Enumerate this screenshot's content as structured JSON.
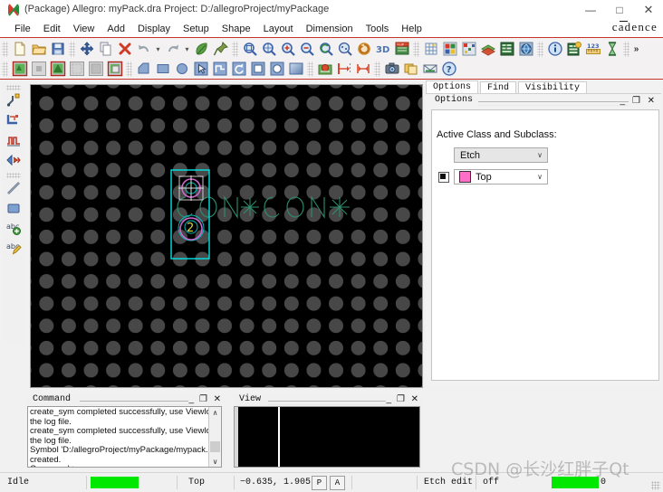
{
  "window": {
    "title": "(Package) Allegro: myPack.dra   Project: D:/allegroProject/myPackage",
    "app_icon": "allegro-icon",
    "minimize": "—",
    "maximize": "□",
    "close": "✕",
    "brand": "cadence"
  },
  "menu": {
    "items": [
      {
        "label": "File"
      },
      {
        "label": "Edit"
      },
      {
        "label": "View"
      },
      {
        "label": "Add"
      },
      {
        "label": "Display"
      },
      {
        "label": "Setup"
      },
      {
        "label": "Shape"
      },
      {
        "label": "Layout"
      },
      {
        "label": "Dimension"
      },
      {
        "label": "Tools"
      },
      {
        "label": "Help"
      }
    ]
  },
  "toolbar": {
    "row1": [
      {
        "icon": "new-file-icon",
        "name": "new-button"
      },
      {
        "icon": "open-folder-icon",
        "name": "open-button"
      },
      {
        "icon": "save-disk-icon",
        "name": "save-button"
      },
      {
        "icon": "move-icon",
        "name": "move-button"
      },
      {
        "icon": "copy-icon",
        "name": "copy-button"
      },
      {
        "icon": "delete-x-icon",
        "name": "delete-button"
      },
      {
        "icon": "undo-icon",
        "name": "undo-button"
      },
      {
        "icon": "chevron-down-icon",
        "name": "undo-history-dropdown"
      },
      {
        "icon": "redo-icon",
        "name": "redo-button"
      },
      {
        "icon": "chevron-down-icon",
        "name": "redo-history-dropdown"
      },
      {
        "icon": "leaf-icon",
        "name": "property-button"
      },
      {
        "icon": "pin-icon",
        "name": "pin-button"
      },
      {
        "icon": "zoom-fit-icon",
        "name": "zoom-fit-button"
      },
      {
        "icon": "zoom-world-icon",
        "name": "zoom-world-button"
      },
      {
        "icon": "zoom-in-icon",
        "name": "zoom-in-button"
      },
      {
        "icon": "zoom-out-icon",
        "name": "zoom-out-button"
      },
      {
        "icon": "zoom-prev-icon",
        "name": "zoom-previous-button"
      },
      {
        "icon": "zoom-points-icon",
        "name": "zoom-points-button"
      },
      {
        "icon": "refresh-icon",
        "name": "redraw-button"
      },
      {
        "icon": "3d-view-icon",
        "name": "3d-canvas-button"
      },
      {
        "icon": "flip-design-icon",
        "name": "flip-design-button"
      },
      {
        "icon": "grid-toggle-icon",
        "name": "grid-toggle-button"
      },
      {
        "icon": "color-view-icon",
        "name": "color-visibility-button"
      },
      {
        "icon": "subclass-icon",
        "name": "subclass-button"
      },
      {
        "icon": "layers-icon",
        "name": "layers-button"
      },
      {
        "icon": "constraint-manager-icon",
        "name": "constraint-manager-button"
      },
      {
        "icon": "globe-icon",
        "name": "dfa-button"
      },
      {
        "icon": "info-icon",
        "name": "show-element-button"
      },
      {
        "icon": "report-icon",
        "name": "reports-button"
      },
      {
        "icon": "measure-icon",
        "name": "measure-button"
      },
      {
        "icon": "hourglass-icon",
        "name": "status-button"
      },
      {
        "icon": "overflow-chevrons-icon",
        "name": "toolbar-overflow"
      }
    ],
    "row2": [
      {
        "icon": "shape-add-icon",
        "name": "shape-add-button"
      },
      {
        "icon": "shape-gray-icon",
        "name": "shape-select-button"
      },
      {
        "icon": "shape-edit-icon",
        "name": "shape-edit-button"
      },
      {
        "icon": "shape-grid1-icon",
        "name": "shape-grid1-button"
      },
      {
        "icon": "shape-grid2-icon",
        "name": "shape-grid2-button"
      },
      {
        "icon": "shape-compose-icon",
        "name": "shape-compose-button"
      },
      {
        "icon": "polygon-icon",
        "name": "add-polygon-button"
      },
      {
        "icon": "rectangle-icon",
        "name": "add-rectangle-button"
      },
      {
        "icon": "circle-icon",
        "name": "add-circle-button"
      },
      {
        "icon": "cursor-select-icon",
        "name": "select-shape-button"
      },
      {
        "icon": "shape-path-icon",
        "name": "shape-path-button"
      },
      {
        "icon": "rotate-icon",
        "name": "rotate-button"
      },
      {
        "icon": "square-outline-icon",
        "name": "square-outline-button"
      },
      {
        "icon": "circle-outline-icon",
        "name": "circle-outline-button"
      },
      {
        "icon": "gradient-square-icon",
        "name": "gradient-shape-button"
      },
      {
        "icon": "place-part-icon",
        "name": "place-manual-button"
      },
      {
        "icon": "dim-left-icon",
        "name": "dimension-left-button"
      },
      {
        "icon": "dim-linear-icon",
        "name": "dimension-linear-button"
      },
      {
        "icon": "camera-icon",
        "name": "snapshot-button"
      },
      {
        "icon": "windows-icon",
        "name": "cascade-windows-button"
      },
      {
        "icon": "mail-icon",
        "name": "mail-button"
      },
      {
        "icon": "help-icon",
        "name": "help-button"
      }
    ]
  },
  "left_toolbar": {
    "items": [
      {
        "icon": "add-connect-icon",
        "name": "add-connect-button"
      },
      {
        "icon": "slide-icon",
        "name": "slide-button"
      },
      {
        "icon": "delay-tune-icon",
        "name": "delay-tune-button"
      },
      {
        "icon": "custom-smooth-icon",
        "name": "custom-smooth-button"
      },
      {
        "icon": "line-icon",
        "name": "add-line-button"
      },
      {
        "icon": "rect-filled-icon",
        "name": "add-rect-button"
      },
      {
        "icon": "add-text-icon",
        "name": "add-text-button"
      },
      {
        "icon": "edit-text-icon",
        "name": "edit-text-button"
      }
    ]
  },
  "canvas": {
    "name": "design-canvas",
    "background": "#000000",
    "grid_dot_color": "#828282",
    "padstack_outline_color": "#00e5e5",
    "pad_color": "#cc66cc",
    "silkscreen_color": "#2f8f6f",
    "drill_cross_color": "#e8e8e8",
    "pin_label_color": "#d8d83a",
    "labels": {
      "silk_text_left": "CON",
      "silk_text_right": "CON",
      "pin_2_label": "2"
    }
  },
  "panel": {
    "tabs": [
      {
        "label": "Options",
        "active": true,
        "name": "tab-options"
      },
      {
        "label": "Find",
        "active": false,
        "name": "tab-find"
      },
      {
        "label": "Visibility",
        "active": false,
        "name": "tab-visibility"
      }
    ],
    "title": "Options",
    "window_buttons": {
      "minimize": "_",
      "restore": "❐",
      "close": "✕"
    },
    "active_class_label": "Active Class and Subclass:",
    "class_value": "Etch",
    "subclass_value": "Top",
    "subclass_color": "#ff6ec7",
    "dropdown_arrow": "∨"
  },
  "command_window": {
    "title": "Command",
    "window_buttons": {
      "minimize": "_",
      "restore": "❐",
      "close": "✕"
    },
    "lines": [
      "create_sym completed successfully, use Viewlog to review",
      "the log file.",
      "create_sym completed successfully, use Viewlog to review",
      "the log file.",
      "Symbol 'D:/allegroProject/myPackage/mypack.psm'",
      "created.",
      "Command >"
    ],
    "scroll_up": "∧",
    "scroll_down": "∨"
  },
  "view_window": {
    "title": "View",
    "window_buttons": {
      "minimize": "_",
      "restore": "❐",
      "close": "✕"
    }
  },
  "status_bar": {
    "state": "Idle",
    "progress_color": "#00e800",
    "layer": "Top",
    "coordinates": "−0.635,  1.905",
    "key_p": "P",
    "key_a": "A",
    "mode_label": "Etch edit",
    "mode_value": "off",
    "right_value": "0"
  },
  "watermark": {
    "text": "CSDN @长沙红胖子Qt"
  }
}
